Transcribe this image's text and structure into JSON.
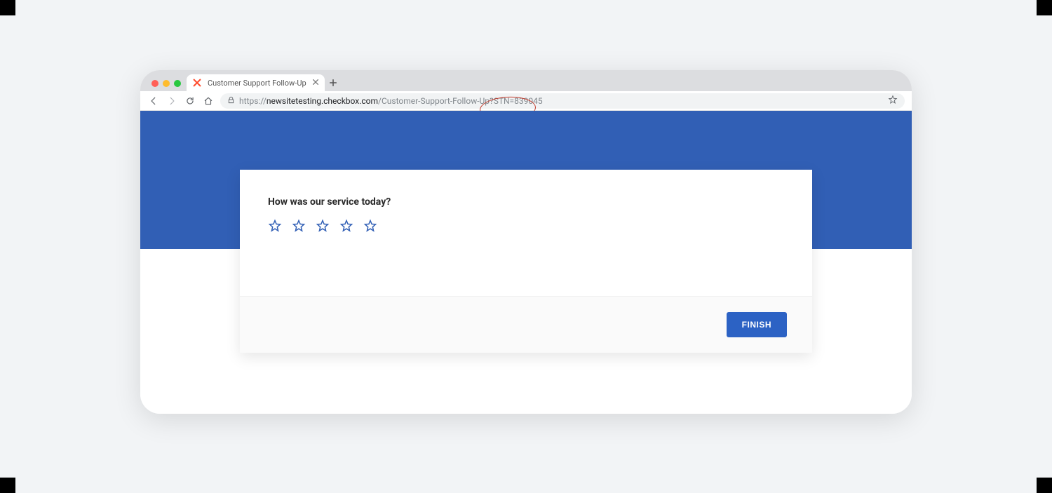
{
  "browser": {
    "tab": {
      "favicon_label": "checkbox-favicon",
      "title": "Customer Support Follow-Up"
    },
    "url": {
      "prefix": "https://",
      "host": "newsitetesting.checkbox.com",
      "path": "/Customer-Support-Follow-Up?STN=839045"
    }
  },
  "survey": {
    "question": "How was our service today?",
    "rating_max": 5,
    "finish_label": "FINISH"
  },
  "annotation": {
    "highlight": "?STN=839045"
  }
}
